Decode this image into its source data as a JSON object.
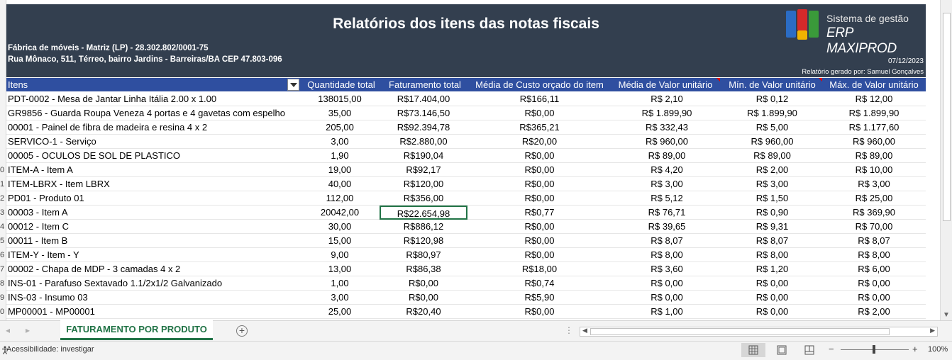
{
  "report": {
    "title": "Relatórios dos itens das notas fiscais",
    "company": "Fábrica de móveis - Matriz (LP) - 28.302.802/0001-75",
    "address": "Rua Mônaco, 511, Térreo, bairro Jardins - Barreiras/BA CEP 47.803-096",
    "date": "07/12/2023",
    "generated_by": "Relatório gerado por: Samuel Gonçalves",
    "logo_system": "Sistema de gestão",
    "logo_brand": "ERP MAXIPROD"
  },
  "columns": {
    "items": "Itens",
    "qty": "Quantidade total",
    "revenue": "Faturamento total",
    "avg_cost": "Média de Custo orçado do item",
    "avg_unit": "Média de Valor unitário",
    "min_unit": "Mín. de Valor unitário",
    "max_unit": "Máx. de Valor unitário"
  },
  "row_numbers": [
    "",
    "",
    "",
    "",
    "",
    "",
    "0",
    "1",
    "2",
    "3",
    "4",
    "5",
    "6",
    "7",
    "8",
    "9",
    "0"
  ],
  "rows": [
    {
      "item": "PDT-0002 - Mesa de Jantar Linha Itália 2.00 x 1.00",
      "qty": "138015,00",
      "revenue": "R$17.404,00",
      "avg_cost": "R$166,11",
      "avg_unit": "R$ 2,10",
      "min_unit": "R$ 0,12",
      "max_unit": "R$ 12,00"
    },
    {
      "item": "GR9856 - Guarda Roupa Veneza 4 portas e 4 gavetas com espelho",
      "qty": "35,00",
      "revenue": "R$73.146,50",
      "avg_cost": "R$0,00",
      "avg_unit": "R$ 1.899,90",
      "min_unit": "R$ 1.899,90",
      "max_unit": "R$ 1.899,90"
    },
    {
      "item": "00001 - Painel de fibra de madeira e resina 4 x 2",
      "qty": "205,00",
      "revenue": "R$92.394,78",
      "avg_cost": "R$365,21",
      "avg_unit": "R$ 332,43",
      "min_unit": "R$ 5,00",
      "max_unit": "R$ 1.177,60"
    },
    {
      "item": "SERVICO-1 - Serviço",
      "qty": "3,00",
      "revenue": "R$2.880,00",
      "avg_cost": "R$20,00",
      "avg_unit": "R$ 960,00",
      "min_unit": "R$ 960,00",
      "max_unit": "R$ 960,00"
    },
    {
      "item": "00005 - OCULOS DE SOL DE PLASTICO",
      "qty": "1,90",
      "revenue": "R$190,04",
      "avg_cost": "R$0,00",
      "avg_unit": "R$ 89,00",
      "min_unit": "R$ 89,00",
      "max_unit": "R$ 89,00"
    },
    {
      "item": "ITEM-A - Item A",
      "qty": "19,00",
      "revenue": "R$92,17",
      "avg_cost": "R$0,00",
      "avg_unit": "R$ 4,20",
      "min_unit": "R$ 2,00",
      "max_unit": "R$ 10,00"
    },
    {
      "item": "ITEM-LBRX - Item LBRX",
      "qty": "40,00",
      "revenue": "R$120,00",
      "avg_cost": "R$0,00",
      "avg_unit": "R$ 3,00",
      "min_unit": "R$ 3,00",
      "max_unit": "R$ 3,00"
    },
    {
      "item": "PD01 - Produto 01",
      "qty": "112,00",
      "revenue": "R$356,00",
      "avg_cost": "R$0,00",
      "avg_unit": "R$ 5,12",
      "min_unit": "R$ 1,50",
      "max_unit": "R$ 25,00"
    },
    {
      "item": "00003 - Item A",
      "qty": "20042,00",
      "revenue": "R$22.654,98",
      "avg_cost": "R$0,77",
      "avg_unit": "R$ 76,71",
      "min_unit": "R$ 0,90",
      "max_unit": "R$ 369,90"
    },
    {
      "item": "00012 - Item C",
      "qty": "30,00",
      "revenue": "R$886,12",
      "avg_cost": "R$0,00",
      "avg_unit": "R$ 39,65",
      "min_unit": "R$ 9,31",
      "max_unit": "R$ 70,00"
    },
    {
      "item": "00011 - Item B",
      "qty": "15,00",
      "revenue": "R$120,98",
      "avg_cost": "R$0,00",
      "avg_unit": "R$ 8,07",
      "min_unit": "R$ 8,07",
      "max_unit": "R$ 8,07"
    },
    {
      "item": "ITEM-Y - Item - Y",
      "qty": "9,00",
      "revenue": "R$80,97",
      "avg_cost": "R$0,00",
      "avg_unit": "R$ 8,00",
      "min_unit": "R$ 8,00",
      "max_unit": "R$ 8,00"
    },
    {
      "item": "00002 - Chapa de MDP - 3 camadas 4 x 2",
      "qty": "13,00",
      "revenue": "R$86,38",
      "avg_cost": "R$18,00",
      "avg_unit": "R$ 3,60",
      "min_unit": "R$ 1,20",
      "max_unit": "R$ 6,00"
    },
    {
      "item": "INS-01 - Parafuso Sextavado 1.1/2x1/2 Galvanizado",
      "qty": "1,00",
      "revenue": "R$0,00",
      "avg_cost": "R$0,74",
      "avg_unit": "R$ 0,00",
      "min_unit": "R$ 0,00",
      "max_unit": "R$ 0,00"
    },
    {
      "item": "INS-03 - Insumo 03",
      "qty": "3,00",
      "revenue": "R$0,00",
      "avg_cost": "R$5,90",
      "avg_unit": "R$ 0,00",
      "min_unit": "R$ 0,00",
      "max_unit": "R$ 0,00"
    },
    {
      "item": "MP00001 - MP00001",
      "qty": "25,00",
      "revenue": "R$20,40",
      "avg_cost": "R$0,00",
      "avg_unit": "R$ 1,00",
      "min_unit": "R$ 0,00",
      "max_unit": "R$ 2,00"
    }
  ],
  "selected_row": 8,
  "sheet_tab": "FATURAMENTO POR PRODUTO",
  "status": {
    "accessibility": "Acessibilidade: investigar",
    "zoom": "100%"
  },
  "icons": [
    "filter-dropdown-icon",
    "add-sheet-icon",
    "normal-view-icon",
    "page-layout-icon",
    "page-break-icon"
  ]
}
